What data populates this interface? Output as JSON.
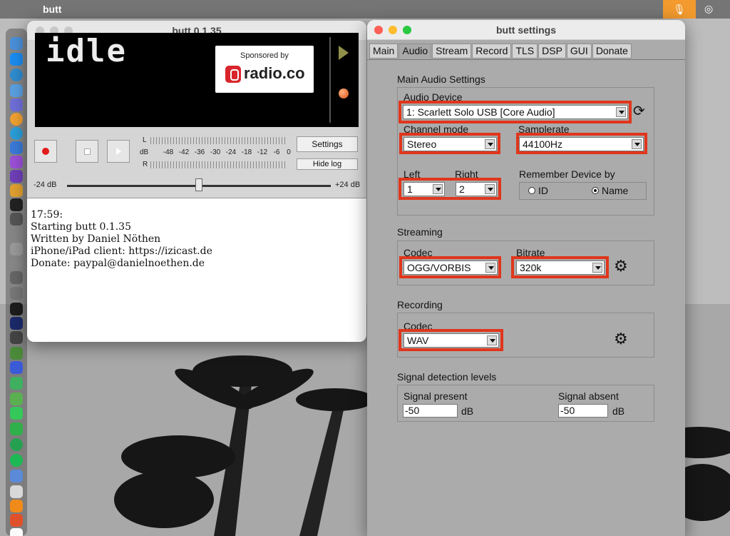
{
  "menubar": {
    "app_name": "butt"
  },
  "main_window": {
    "title": "butt 0.1.35",
    "display_text": "idle",
    "sponsor": {
      "top": "Sponsored by",
      "name": "radio.co"
    },
    "vu": {
      "left": "L",
      "db": "dB",
      "right": "R",
      "scale": [
        "-48",
        "-42",
        "-36",
        "-30",
        "-24",
        "-18",
        "-12",
        "-6",
        "0"
      ]
    },
    "settings_label": "Settings",
    "hide_log_label": "Hide log",
    "slider_min": "-24 dB",
    "slider_max": "+24 dB",
    "log": [
      "17:59:",
      "Starting butt 0.1.35",
      "Written by Daniel Nöthen",
      "iPhone/iPad client: https://izicast.de",
      "Donate: paypal@danielnoethen.de"
    ]
  },
  "settings_window": {
    "title": "butt settings",
    "tabs": [
      "Main",
      "Audio",
      "Stream",
      "Record",
      "TLS",
      "DSP",
      "GUI",
      "Donate"
    ],
    "active_tab": "Audio",
    "main_audio": {
      "group_label": "Main Audio Settings",
      "device_label": "Audio Device",
      "device_value": "1: Scarlett Solo USB [Core Audio]",
      "channel_label": "Channel mode",
      "channel_value": "Stereo",
      "samplerate_label": "Samplerate",
      "samplerate_value": "44100Hz",
      "left_label": "Left",
      "left_value": "1",
      "right_label": "Right",
      "right_value": "2",
      "remember_label": "Remember Device by",
      "remember_options": [
        "ID",
        "Name"
      ],
      "remember_selected": "Name"
    },
    "streaming": {
      "group_label": "Streaming",
      "codec_label": "Codec",
      "codec_value": "OGG/VORBIS",
      "bitrate_label": "Bitrate",
      "bitrate_value": "320k"
    },
    "recording": {
      "group_label": "Recording",
      "codec_label": "Codec",
      "codec_value": "WAV"
    },
    "signal": {
      "group_label": "Signal detection levels",
      "present_label": "Signal present",
      "present_value": "-50",
      "absent_label": "Signal absent",
      "absent_value": "-50",
      "unit": "dB"
    }
  },
  "colors": {
    "highlight": "#e0361c",
    "record": "#e21b1b",
    "recorder_button": "#f29a2e"
  }
}
